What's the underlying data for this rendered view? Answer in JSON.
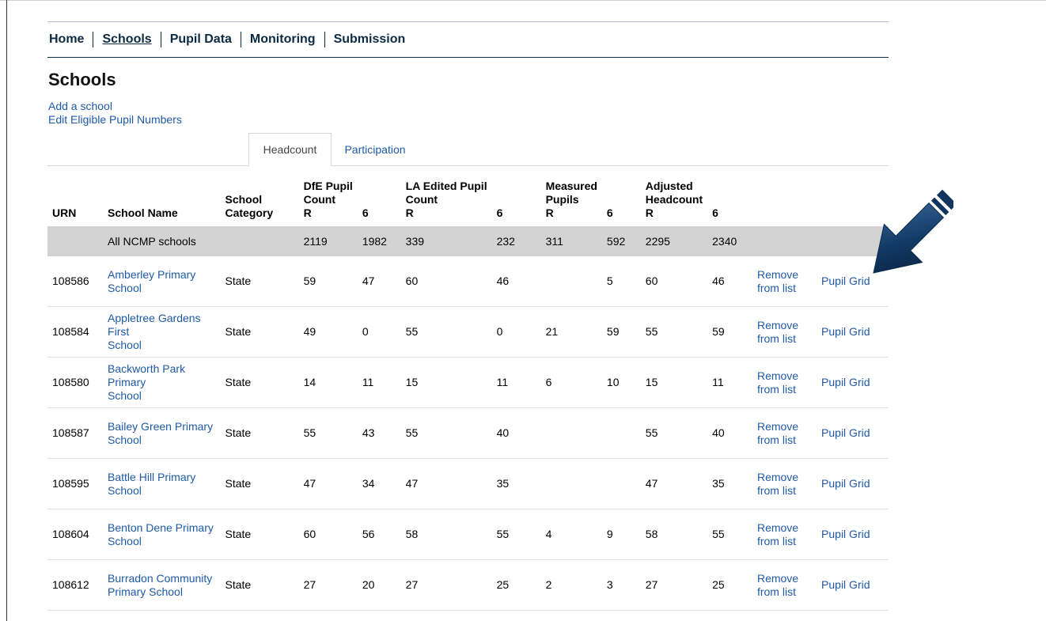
{
  "nav": {
    "items": [
      {
        "label": "Home"
      },
      {
        "label": "Schools"
      },
      {
        "label": "Pupil Data"
      },
      {
        "label": "Monitoring"
      },
      {
        "label": "Submission"
      }
    ]
  },
  "page": {
    "title": "Schools",
    "links": [
      "Add a school",
      "Edit Eligible Pupil Numbers"
    ]
  },
  "tabs": [
    "Headcount",
    "Participation"
  ],
  "table": {
    "headers": {
      "urn": "URN",
      "name": "School Name",
      "category_line1": "School",
      "category_line2": "Category",
      "dfe_line1": "DfE Pupil",
      "dfe_line2": "Count",
      "la_line1": "LA Edited Pupil",
      "la_line2": "Count",
      "measured_line1": "Measured",
      "measured_line2": "Pupils",
      "adjusted_line1": "Adjusted",
      "adjusted_line2": "Headcount",
      "sub_r": "R",
      "sub_6": "6"
    },
    "summary": {
      "name": "All NCMP schools",
      "dfe_r": "2119",
      "dfe_6": "1982",
      "la_r": "339",
      "la_6": "232",
      "m_r": "311",
      "m_6": "592",
      "a_r": "2295",
      "a_6": "2340"
    },
    "remove_label_1": "Remove",
    "remove_label_2": "from list",
    "grid_label": "Pupil Grid",
    "rows": [
      {
        "urn": "108586",
        "name1": "Amberley Primary School",
        "name2": "",
        "category": "State",
        "dfe_r": "59",
        "dfe_6": "47",
        "la_r": "60",
        "la_6": "46",
        "m_r": "",
        "m_6": "5",
        "a_r": "60",
        "a_6": "46"
      },
      {
        "urn": "108584",
        "name1": "Appletree Gardens First",
        "name2": "School",
        "category": "State",
        "dfe_r": "49",
        "dfe_6": "0",
        "la_r": "55",
        "la_6": "0",
        "m_r": "21",
        "m_6": "59",
        "a_r": "55",
        "a_6": "59"
      },
      {
        "urn": "108580",
        "name1": "Backworth Park Primary",
        "name2": "School",
        "category": "State",
        "dfe_r": "14",
        "dfe_6": "11",
        "la_r": "15",
        "la_6": "11",
        "m_r": "6",
        "m_6": "10",
        "a_r": "15",
        "a_6": "11"
      },
      {
        "urn": "108587",
        "name1": "Bailey Green Primary",
        "name2": "School",
        "category": "State",
        "dfe_r": "55",
        "dfe_6": "43",
        "la_r": "55",
        "la_6": "40",
        "m_r": "",
        "m_6": "",
        "a_r": "55",
        "a_6": "40"
      },
      {
        "urn": "108595",
        "name1": "Battle Hill Primary School",
        "name2": "",
        "category": "State",
        "dfe_r": "47",
        "dfe_6": "34",
        "la_r": "47",
        "la_6": "35",
        "m_r": "",
        "m_6": "",
        "a_r": "47",
        "a_6": "35"
      },
      {
        "urn": "108604",
        "name1": "Benton Dene Primary",
        "name2": "School",
        "category": "State",
        "dfe_r": "60",
        "dfe_6": "56",
        "la_r": "58",
        "la_6": "55",
        "m_r": "4",
        "m_6": "9",
        "a_r": "58",
        "a_6": "55"
      },
      {
        "urn": "108612",
        "name1": "Burradon Community",
        "name2": "Primary School",
        "category": "State",
        "dfe_r": "27",
        "dfe_6": "20",
        "la_r": "27",
        "la_6": "25",
        "m_r": "2",
        "m_6": "3",
        "a_r": "27",
        "a_6": "25"
      }
    ]
  },
  "colors": {
    "link": "#1e5aa6",
    "nav_text": "#0b2a44",
    "summary_bg": "#d3d3d3",
    "arrow": "#0e2e55"
  },
  "icons": {
    "pointer": "arrow-pointer-icon"
  }
}
